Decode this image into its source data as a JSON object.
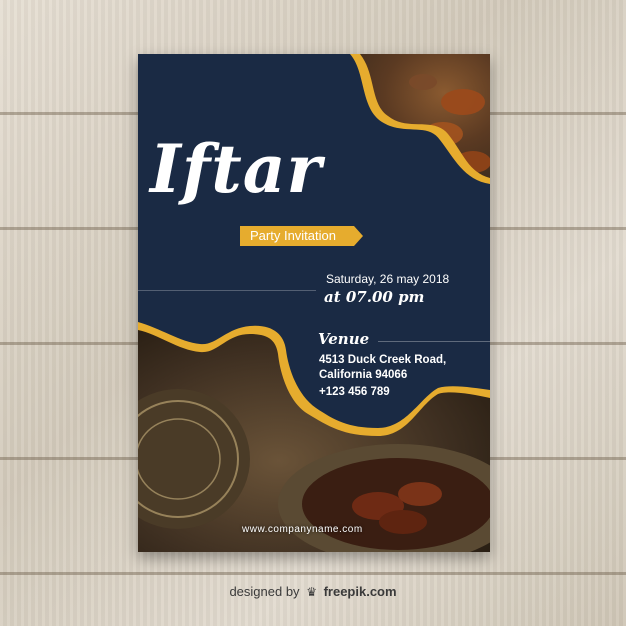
{
  "card": {
    "title": "Iftar",
    "subtitle": "Party Invitation",
    "date": "Saturday, 26 may 2018",
    "time": "at 07.00 pm",
    "venue_title": "Venue",
    "address_line1": "4513 Duck Creek Road,",
    "address_line2": "California 94066",
    "phone": "+123 456 789",
    "website": "www.companyname.com"
  },
  "credit": {
    "prefix": "designed by",
    "icon": "crown-icon",
    "brand": "freepik.com"
  },
  "colors": {
    "navy": "#1a2a44",
    "gold": "#e6ac2e",
    "wood": "#ddd5c8"
  }
}
